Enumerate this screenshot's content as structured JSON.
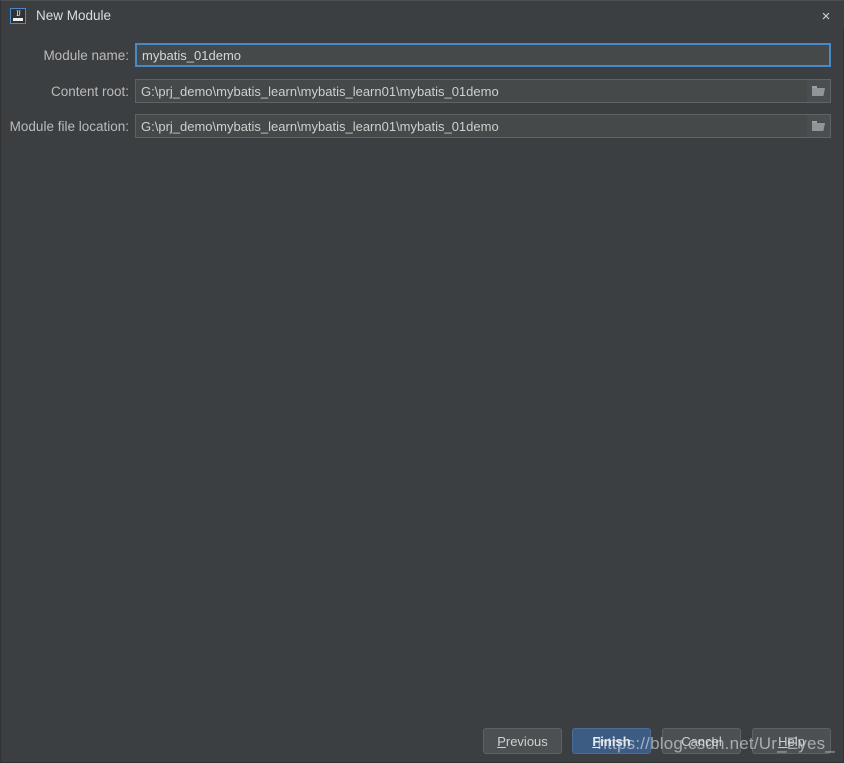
{
  "window": {
    "title": "New Module",
    "app_icon": "intellij-idea-icon",
    "close_label": "×"
  },
  "form": {
    "fields": [
      {
        "label": "Module name:",
        "value": "mybatis_01demo",
        "placeholder": "",
        "focused": true,
        "has_browse": false,
        "browse_icon": ""
      },
      {
        "label": "Content root:",
        "value": "G:\\prj_demo\\mybatis_learn\\mybatis_learn01\\mybatis_01demo",
        "placeholder": "",
        "focused": false,
        "has_browse": true,
        "browse_icon": "folder-icon"
      },
      {
        "label": "Module file location:",
        "value": "G:\\prj_demo\\mybatis_learn\\mybatis_learn01\\mybatis_01demo",
        "placeholder": "",
        "focused": false,
        "has_browse": true,
        "browse_icon": "folder-icon"
      }
    ]
  },
  "buttons": {
    "previous": {
      "mnemonic": "P",
      "rest": "revious"
    },
    "finish": {
      "mnemonic": "F",
      "rest": "inish"
    },
    "cancel": {
      "mnemonic": "",
      "rest": "Cancel"
    },
    "help": {
      "mnemonic": "H",
      "rest": "elp"
    }
  },
  "watermark": {
    "text": "https://blog.csdn.net/Ur_Eyes_"
  },
  "colors": {
    "dialog_bg": "#3c3f41",
    "field_bg": "#45494a",
    "focus_border": "#4a88c7",
    "primary_button": "#3c5c84",
    "text": "#bbbbbb"
  }
}
